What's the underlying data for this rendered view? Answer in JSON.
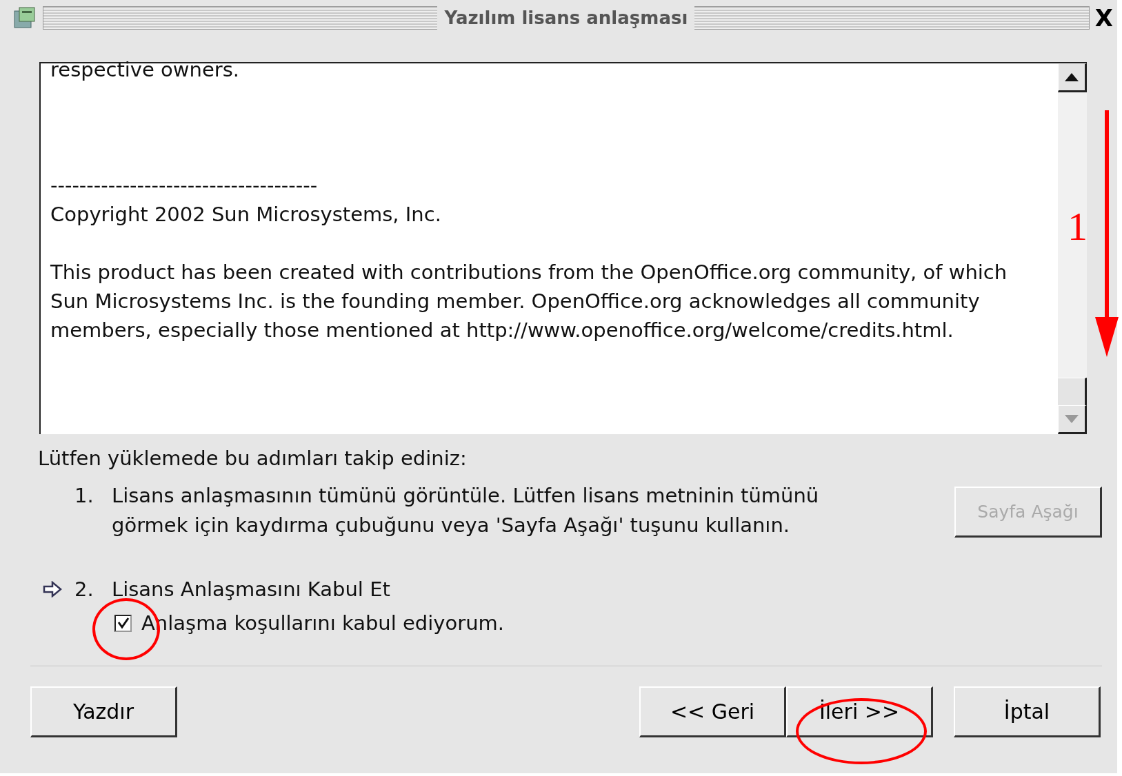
{
  "window": {
    "title": "Yazılım lisans anlaşması",
    "close": "X"
  },
  "license_text": [
    {
      "text": "respective owners.",
      "kind": "line"
    },
    {
      "text": "-------------------------------------",
      "kind": "after_large_gap"
    },
    {
      "text": "Copyright 2002 Sun Microsystems, Inc.",
      "kind": "line"
    },
    {
      "text": "This product has been created with contributions from the OpenOffice.org community, of which Sun Microsystems Inc. is the founding member. OpenOffice.org acknowledges all community members, especially those mentioned at http://www.openoffice.org/welcome/credits.html.",
      "kind": "after_gap"
    }
  ],
  "instruction": "Lütfen yüklemede bu adımları takip ediniz:",
  "steps": [
    {
      "number": "1.",
      "text": "Lisans anlaşmasının tümünü görüntüle. Lütfen lisans metninin tümünü görmek için kaydırma çubuğunu veya 'Sayfa Aşağı' tuşunu kullanın.",
      "current": false,
      "button": {
        "label": "Sayfa Aşağı",
        "disabled": true
      }
    },
    {
      "number": "2.",
      "text": "Lisans Anlaşmasını Kabul Et",
      "current": true,
      "checkbox": {
        "label": "Anlaşma koşullarını kabul ediyorum.",
        "checked": true
      }
    }
  ],
  "buttons": [
    "Yazdır",
    "<< Geri",
    "İleri >>",
    "İptal"
  ],
  "annotations": {
    "scroll_label": "1"
  }
}
